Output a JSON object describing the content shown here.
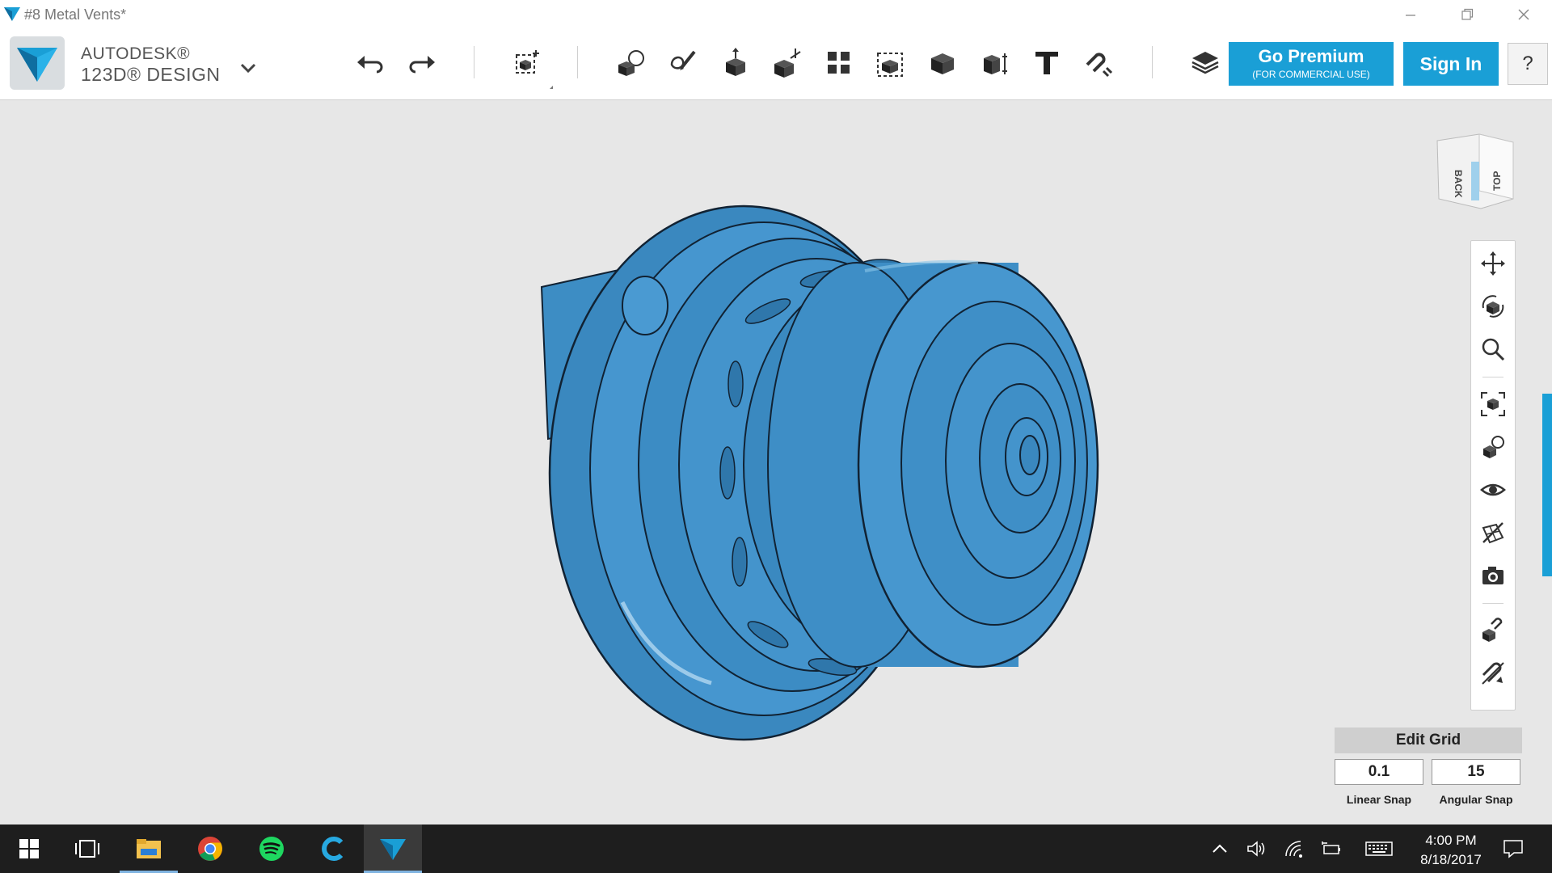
{
  "window": {
    "title": "#8 Metal Vents*"
  },
  "brand": {
    "line1": "AUTODESK®",
    "line2": "123D® DESIGN"
  },
  "toolbar": {
    "premium_label": "Go Premium",
    "premium_sub": "(FOR COMMERCIAL USE)",
    "signin_label": "Sign In",
    "help_label": "?"
  },
  "navcube": {
    "face_back": "BACK",
    "face_top": "TOP"
  },
  "grid": {
    "edit_label": "Edit Grid",
    "linear_value": "0.1",
    "angular_value": "15",
    "linear_label": "Linear Snap",
    "angular_label": "Angular Snap"
  },
  "taskbar": {
    "time": "4:00 PM",
    "date": "8/18/2017"
  },
  "colors": {
    "accent": "#1a9fd6",
    "model": "#3f8fc7",
    "taskbar": "#1e1e1e"
  }
}
